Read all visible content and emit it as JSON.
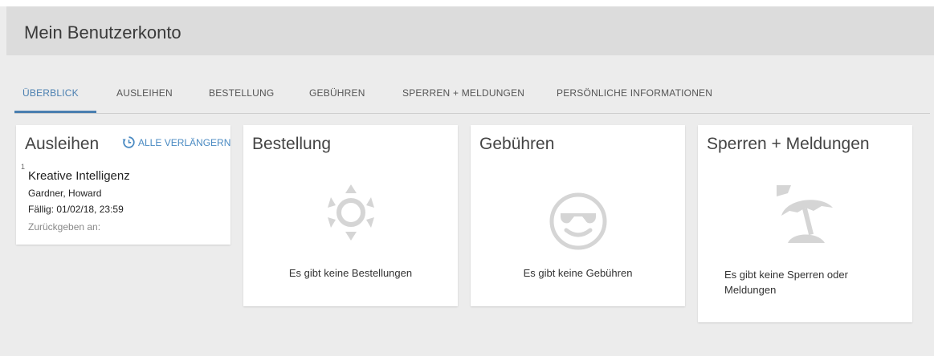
{
  "header": {
    "title": "Mein Benutzerkonto"
  },
  "tabs": [
    {
      "label": "ÜBERBLICK"
    },
    {
      "label": "AUSLEIHEN"
    },
    {
      "label": "BESTELLUNG"
    },
    {
      "label": "GEBÜHREN"
    },
    {
      "label": "SPERREN + MELDUNGEN"
    },
    {
      "label": "PERSÖNLICHE INFORMATIONEN"
    }
  ],
  "loans": {
    "title": "Ausleihen",
    "renew_all": "ALLE VERLÄNGERN",
    "item": {
      "number": "1",
      "title": "Kreative Intelligenz",
      "author": "Gardner, Howard",
      "due": "Fällig: 01/02/18, 23:59",
      "return_at": "Zurückgeben an:"
    }
  },
  "orders": {
    "title": "Bestellung",
    "empty": "Es gibt keine Bestellungen",
    "icon": "sun-icon"
  },
  "fees": {
    "title": "Gebühren",
    "empty": "Es gibt keine Gebühren",
    "icon": "sunglasses-smiley-icon"
  },
  "blocks": {
    "title": "Sperren + Meldungen",
    "empty_line1": "Es gibt keine Sperren oder",
    "empty_line2": "Meldungen",
    "icon": "beach-umbrella-icon"
  },
  "colors": {
    "accent": "#4a7fb0",
    "link": "#4a8ac2",
    "icon_gray": "#cfcfcf"
  }
}
